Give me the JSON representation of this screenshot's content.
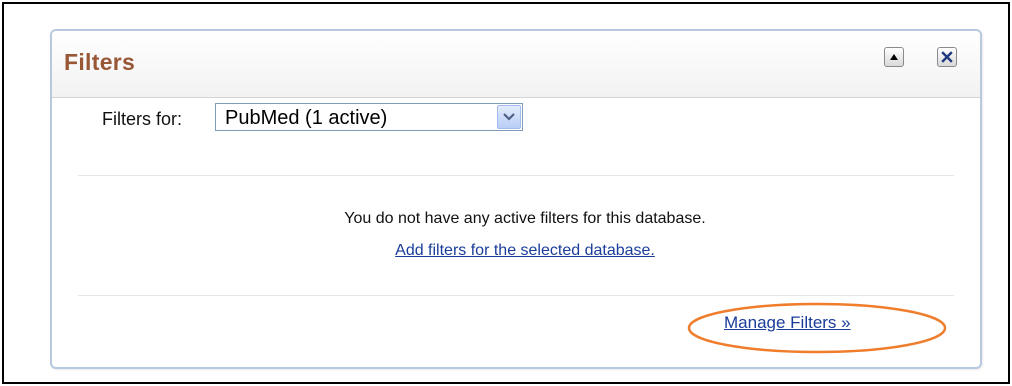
{
  "panel": {
    "title": "Filters",
    "collapse_icon": "triangle-up-icon",
    "close_icon": "x-close-icon"
  },
  "filters_for": {
    "label": "Filters for:",
    "selected_value": "PubMed (1 active)"
  },
  "message": {
    "text": "You do not have any active filters for this database.",
    "add_link": "Add filters for the selected database."
  },
  "manage_link": "Manage Filters »",
  "colors": {
    "title": "#985735",
    "link": "#1a3d9a",
    "highlight": "#ef7d2c",
    "panel_border": "#b7c9e0"
  }
}
